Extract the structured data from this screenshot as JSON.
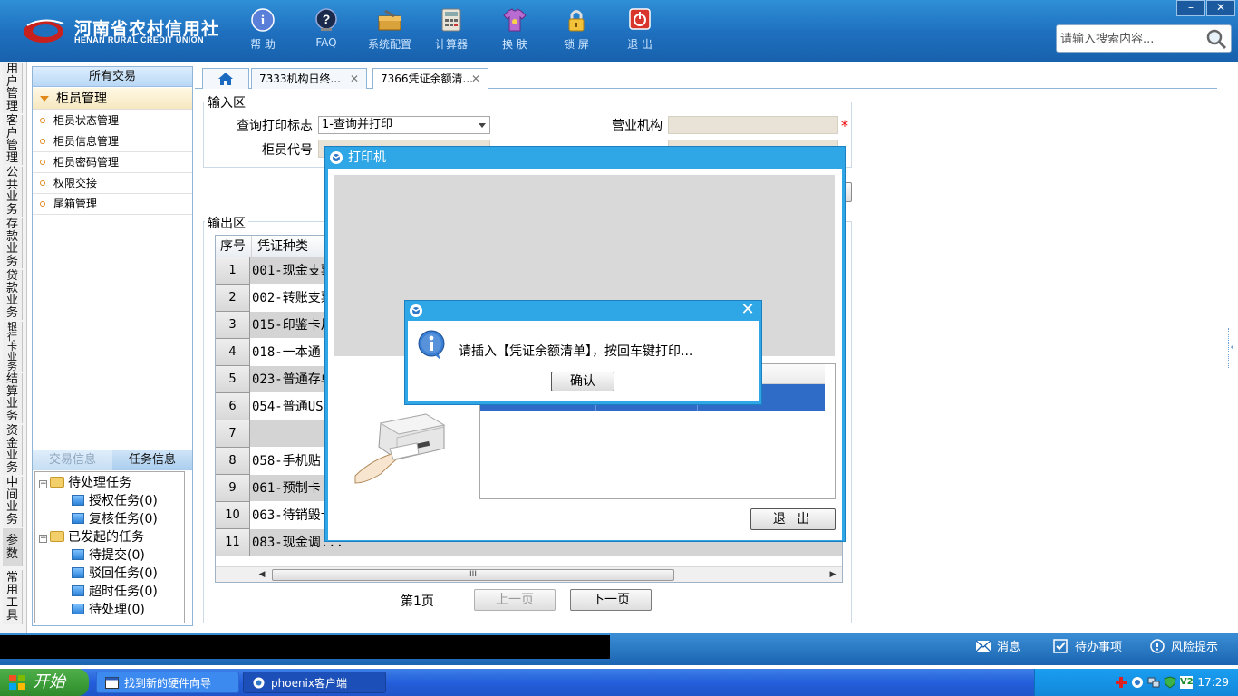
{
  "header": {
    "logo_cn": "河南省农村信用社",
    "logo_en": "HENAN RURAL CREDIT UNION",
    "tools": [
      {
        "label": "帮 助",
        "icon": "help-icon"
      },
      {
        "label": "FAQ",
        "icon": "faq-icon"
      },
      {
        "label": "系统配置",
        "icon": "settings-icon"
      },
      {
        "label": "计算器",
        "icon": "calculator-icon"
      },
      {
        "label": "换 肤",
        "icon": "skin-icon"
      },
      {
        "label": "锁 屏",
        "icon": "lock-icon"
      },
      {
        "label": "退 出",
        "icon": "power-icon"
      }
    ],
    "search_placeholder": "请输入搜索内容..."
  },
  "categories": [
    "用户管理",
    "客户管理",
    "公共业务",
    "存款业务",
    "贷款业务",
    "银行卡业务",
    "结算业务",
    "资金业务",
    "中间业务",
    "参数",
    "常用工具"
  ],
  "sidebar": {
    "header": "所有交易",
    "group": "柜员管理",
    "items": [
      "柜员状态管理",
      "柜员信息管理",
      "柜员密码管理",
      "权限交接",
      "尾箱管理"
    ],
    "tabs": [
      "交易信息",
      "任务信息"
    ],
    "tree": {
      "pending": "待处理任务",
      "auth": "授权任务(0)",
      "review": "复核任务(0)",
      "initiated": "已发起的任务",
      "submit": "待提交(0)",
      "rejected": "驳回任务(0)",
      "timeout": "超时任务(0)",
      "todo": "待处理(0)"
    }
  },
  "tabs": [
    {
      "label": "7333机构日终..."
    },
    {
      "label": "7366凭证余额清..."
    }
  ],
  "form": {
    "input_section": "输入区",
    "query_flag_label": "查询打印标志",
    "query_flag_value": "1-查询并打印",
    "teller_label": "柜员代号",
    "org_label": "营业机构",
    "required_mark": "*",
    "output_section": "输出区"
  },
  "grid": {
    "col_no": "序号",
    "col_type": "凭证种类",
    "rows": [
      {
        "no": "1",
        "text": "001-现金支票"
      },
      {
        "no": "2",
        "text": "002-转账支票"
      },
      {
        "no": "3",
        "text": "015-印鉴卡片"
      },
      {
        "no": "4",
        "text": "018-一本通."
      },
      {
        "no": "5",
        "text": "023-普通存单"
      },
      {
        "no": "6",
        "text": "054-普通US."
      },
      {
        "no": "7",
        "text": ""
      },
      {
        "no": "8",
        "text": "058-手机贴."
      },
      {
        "no": "9",
        "text": "061-预制卡"
      },
      {
        "no": "10",
        "text": "063-待销毁卡"
      },
      {
        "no": "11",
        "text": "083-现金调..."
      }
    ]
  },
  "pagination": {
    "page": "第1页",
    "prev": "上一页",
    "next": "下一页"
  },
  "printer_dialog": {
    "title": "打印机",
    "exit": "退 出"
  },
  "message_box": {
    "text": "请插入【凭证余额清单】，按回车键打印...",
    "ok": "确认",
    "close": "✕"
  },
  "statusbar": {
    "messages": "消息",
    "todo": "待办事项",
    "risk": "风险提示"
  },
  "taskbar": {
    "start": "开始",
    "items": [
      "找到新的硬件向导",
      "phoenix客户端"
    ],
    "clock": "17:29"
  },
  "colors": {
    "header_blue": "#1e6fbe",
    "dialog_blue": "#2fa6e6",
    "required_red": "#e00000"
  }
}
